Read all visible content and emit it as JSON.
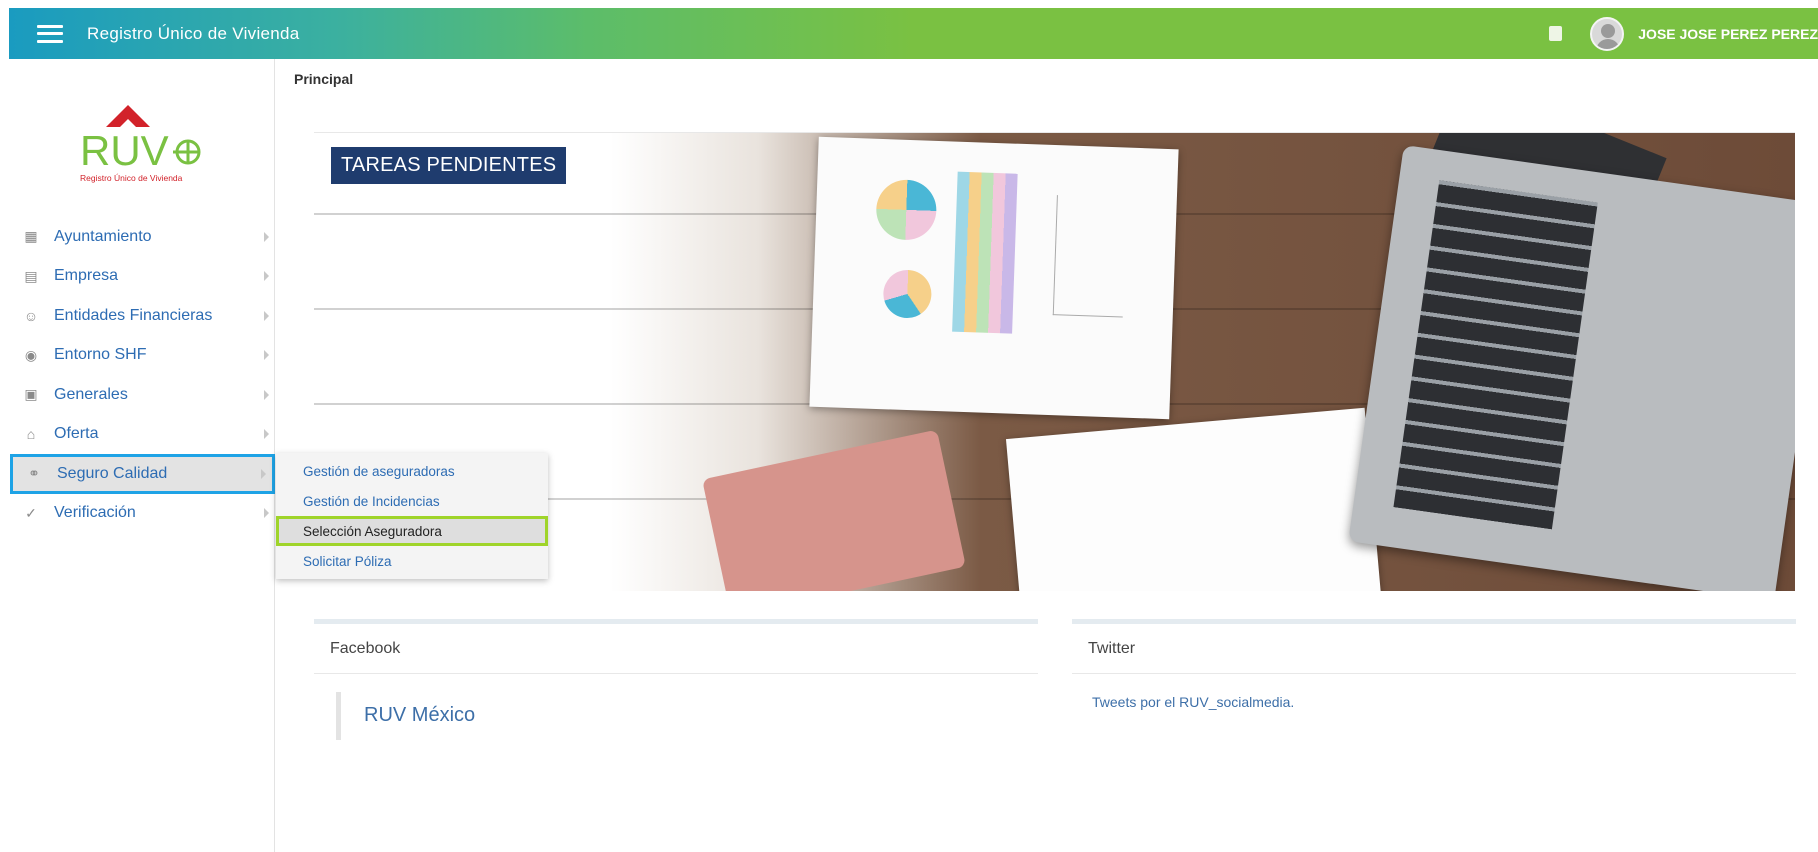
{
  "topbar": {
    "app_title": "Registro Único de Vivienda",
    "username": "JOSE JOSE PEREZ PEREZ"
  },
  "logo": {
    "text": "RUV",
    "subtitle": "Registro Único de Vivienda",
    "colors": {
      "roof": "#d2222a",
      "text": "#7ac142",
      "subtitle": "#d2222a"
    }
  },
  "sidebar": {
    "items": [
      {
        "label": "Ayuntamiento",
        "icon": "map-icon"
      },
      {
        "label": "Empresa",
        "icon": "building-icon"
      },
      {
        "label": "Entidades Financieras",
        "icon": "people-icon"
      },
      {
        "label": "Entorno SHF",
        "icon": "target-icon"
      },
      {
        "label": "Generales",
        "icon": "id-card-icon"
      },
      {
        "label": "Oferta",
        "icon": "house-hand-icon"
      },
      {
        "label": "Seguro Calidad",
        "icon": "handshake-icon"
      },
      {
        "label": "Verificación",
        "icon": "check-circle-icon"
      }
    ]
  },
  "submenu": {
    "items": [
      {
        "label": "Gestión de aseguradoras"
      },
      {
        "label": "Gestión de Incidencias"
      },
      {
        "label": "Selección Aseguradora"
      },
      {
        "label": "Solicitar Póliza"
      }
    ]
  },
  "breadcrumb": "Principal",
  "hero": {
    "title": "TAREAS PENDIENTES"
  },
  "facebook": {
    "heading": "Facebook",
    "link": "RUV México"
  },
  "twitter": {
    "heading": "Twitter",
    "link": "Tweets por el RUV_socialmedia."
  },
  "colors": {
    "active_border": "#1ea3e6",
    "selected_border": "#9fd42a",
    "link": "#2d6cb3",
    "tareas_bg": "#1f3c6e"
  }
}
